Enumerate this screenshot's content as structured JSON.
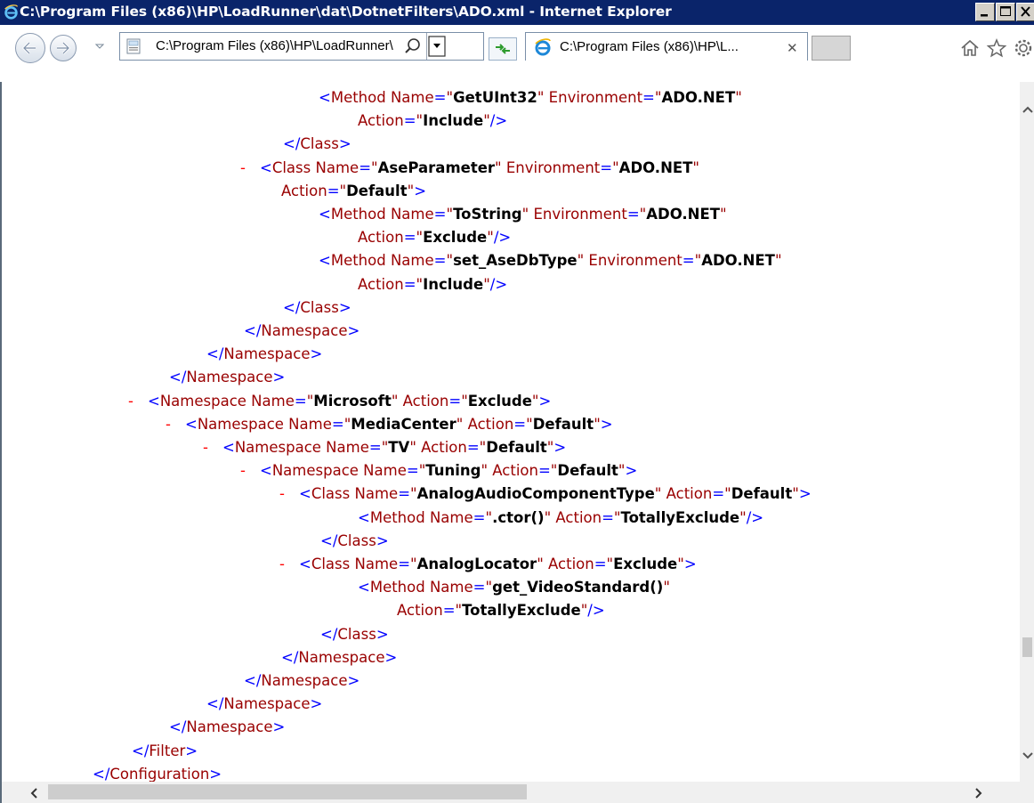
{
  "window": {
    "title": "C:\\Program Files (x86)\\HP\\LoadRunner\\dat\\DotnetFilters\\ADO.xml - Internet Explorer",
    "min_label": "_",
    "max_label": "□",
    "close_label": "✕"
  },
  "toolbar": {
    "address_text": "C:\\Program Files (x86)\\HP\\LoadRunner\\",
    "tab_title": "C:\\Program Files (x86)\\HP\\L...",
    "tab_close": "✕"
  },
  "icons": {
    "title": "ie-logo-icon",
    "back": "back-arrow-icon",
    "forward": "forward-arrow-icon",
    "page": "page-icon",
    "search": "search-icon",
    "refresh": "refresh-icon",
    "home": "home-icon",
    "favorites": "star-icon",
    "tools": "gear-icon"
  },
  "colors": {
    "titlebar": "#0a246a",
    "tag_bracket": "#0000ff",
    "tag_name": "#990000",
    "collapse_hyphen": "#ff0000",
    "value": "#000000"
  },
  "xml_lines": [
    {
      "indent": 356,
      "hy": false,
      "parts": [
        [
          "bk",
          "<"
        ],
        [
          "tg",
          "Method"
        ],
        [
          "at",
          " Name"
        ],
        [
          "bk",
          "="
        ],
        [
          "q",
          "\""
        ],
        [
          "v",
          "GetUInt32"
        ],
        [
          "q",
          "\""
        ],
        [
          "at",
          " Environment"
        ],
        [
          "bk",
          "="
        ],
        [
          "q",
          "\""
        ],
        [
          "v",
          "ADO.NET"
        ],
        [
          "q",
          "\""
        ]
      ]
    },
    {
      "indent": 400,
      "hy": false,
      "parts": [
        [
          "at",
          "Action"
        ],
        [
          "bk",
          "="
        ],
        [
          "q",
          "\""
        ],
        [
          "v",
          "Include"
        ],
        [
          "q",
          "\""
        ],
        [
          "bk",
          "/>"
        ]
      ]
    },
    {
      "indent": 316,
      "hy": false,
      "parts": [
        [
          "bk",
          "</"
        ],
        [
          "tg",
          "Class"
        ],
        [
          "bk",
          ">"
        ]
      ]
    },
    {
      "indent": 290,
      "hy": true,
      "parts": [
        [
          "bk",
          "<"
        ],
        [
          "tg",
          "Class"
        ],
        [
          "at",
          " Name"
        ],
        [
          "bk",
          "="
        ],
        [
          "q",
          "\""
        ],
        [
          "v",
          "AseParameter"
        ],
        [
          "q",
          "\""
        ],
        [
          "at",
          " Environment"
        ],
        [
          "bk",
          "="
        ],
        [
          "q",
          "\""
        ],
        [
          "v",
          "ADO.NET"
        ],
        [
          "q",
          "\""
        ]
      ]
    },
    {
      "indent": 314,
      "hy": false,
      "parts": [
        [
          "at",
          "Action"
        ],
        [
          "bk",
          "="
        ],
        [
          "q",
          "\""
        ],
        [
          "v",
          "Default"
        ],
        [
          "q",
          "\""
        ],
        [
          "bk",
          ">"
        ]
      ]
    },
    {
      "indent": 356,
      "hy": false,
      "parts": [
        [
          "bk",
          "<"
        ],
        [
          "tg",
          "Method"
        ],
        [
          "at",
          " Name"
        ],
        [
          "bk",
          "="
        ],
        [
          "q",
          "\""
        ],
        [
          "v",
          "ToString"
        ],
        [
          "q",
          "\""
        ],
        [
          "at",
          " Environment"
        ],
        [
          "bk",
          "="
        ],
        [
          "q",
          "\""
        ],
        [
          "v",
          "ADO.NET"
        ],
        [
          "q",
          "\""
        ]
      ]
    },
    {
      "indent": 400,
      "hy": false,
      "parts": [
        [
          "at",
          "Action"
        ],
        [
          "bk",
          "="
        ],
        [
          "q",
          "\""
        ],
        [
          "v",
          "Exclude"
        ],
        [
          "q",
          "\""
        ],
        [
          "bk",
          "/>"
        ]
      ]
    },
    {
      "indent": 356,
      "hy": false,
      "parts": [
        [
          "bk",
          "<"
        ],
        [
          "tg",
          "Method"
        ],
        [
          "at",
          " Name"
        ],
        [
          "bk",
          "="
        ],
        [
          "q",
          "\""
        ],
        [
          "v",
          "set_AseDbType"
        ],
        [
          "q",
          "\""
        ],
        [
          "at",
          " Environment"
        ],
        [
          "bk",
          "="
        ],
        [
          "q",
          "\""
        ],
        [
          "v",
          "ADO.NET"
        ],
        [
          "q",
          "\""
        ]
      ]
    },
    {
      "indent": 400,
      "hy": false,
      "parts": [
        [
          "at",
          "Action"
        ],
        [
          "bk",
          "="
        ],
        [
          "q",
          "\""
        ],
        [
          "v",
          "Include"
        ],
        [
          "q",
          "\""
        ],
        [
          "bk",
          "/>"
        ]
      ]
    },
    {
      "indent": 316,
      "hy": false,
      "parts": [
        [
          "bk",
          "</"
        ],
        [
          "tg",
          "Class"
        ],
        [
          "bk",
          ">"
        ]
      ]
    },
    {
      "indent": 272,
      "hy": false,
      "parts": [
        [
          "bk",
          "</"
        ],
        [
          "tg",
          "Namespace"
        ],
        [
          "bk",
          ">"
        ]
      ]
    },
    {
      "indent": 230,
      "hy": false,
      "parts": [
        [
          "bk",
          "</"
        ],
        [
          "tg",
          "Namespace"
        ],
        [
          "bk",
          ">"
        ]
      ]
    },
    {
      "indent": 188,
      "hy": false,
      "parts": [
        [
          "bk",
          "</"
        ],
        [
          "tg",
          "Namespace"
        ],
        [
          "bk",
          ">"
        ]
      ]
    },
    {
      "indent": 164,
      "hy": true,
      "parts": [
        [
          "bk",
          "<"
        ],
        [
          "tg",
          "Namespace"
        ],
        [
          "at",
          " Name"
        ],
        [
          "bk",
          "="
        ],
        [
          "q",
          "\""
        ],
        [
          "v",
          "Microsoft"
        ],
        [
          "q",
          "\""
        ],
        [
          "at",
          " Action"
        ],
        [
          "bk",
          "="
        ],
        [
          "q",
          "\""
        ],
        [
          "v",
          "Exclude"
        ],
        [
          "q",
          "\""
        ],
        [
          "bk",
          ">"
        ]
      ]
    },
    {
      "indent": 206,
      "hy": true,
      "parts": [
        [
          "bk",
          "<"
        ],
        [
          "tg",
          "Namespace"
        ],
        [
          "at",
          " Name"
        ],
        [
          "bk",
          "="
        ],
        [
          "q",
          "\""
        ],
        [
          "v",
          "MediaCenter"
        ],
        [
          "q",
          "\""
        ],
        [
          "at",
          " Action"
        ],
        [
          "bk",
          "="
        ],
        [
          "q",
          "\""
        ],
        [
          "v",
          "Default"
        ],
        [
          "q",
          "\""
        ],
        [
          "bk",
          ">"
        ]
      ]
    },
    {
      "indent": 248,
      "hy": true,
      "parts": [
        [
          "bk",
          "<"
        ],
        [
          "tg",
          "Namespace"
        ],
        [
          "at",
          " Name"
        ],
        [
          "bk",
          "="
        ],
        [
          "q",
          "\""
        ],
        [
          "v",
          "TV"
        ],
        [
          "q",
          "\""
        ],
        [
          "at",
          " Action"
        ],
        [
          "bk",
          "="
        ],
        [
          "q",
          "\""
        ],
        [
          "v",
          "Default"
        ],
        [
          "q",
          "\""
        ],
        [
          "bk",
          ">"
        ]
      ]
    },
    {
      "indent": 290,
      "hy": true,
      "parts": [
        [
          "bk",
          "<"
        ],
        [
          "tg",
          "Namespace"
        ],
        [
          "at",
          " Name"
        ],
        [
          "bk",
          "="
        ],
        [
          "q",
          "\""
        ],
        [
          "v",
          "Tuning"
        ],
        [
          "q",
          "\""
        ],
        [
          "at",
          " Action"
        ],
        [
          "bk",
          "="
        ],
        [
          "q",
          "\""
        ],
        [
          "v",
          "Default"
        ],
        [
          "q",
          "\""
        ],
        [
          "bk",
          ">"
        ]
      ]
    },
    {
      "indent": 334,
      "hy": true,
      "parts": [
        [
          "bk",
          "<"
        ],
        [
          "tg",
          "Class"
        ],
        [
          "at",
          " Name"
        ],
        [
          "bk",
          "="
        ],
        [
          "q",
          "\""
        ],
        [
          "v",
          "AnalogAudioComponentType"
        ],
        [
          "q",
          "\""
        ],
        [
          "at",
          " Action"
        ],
        [
          "bk",
          "="
        ],
        [
          "q",
          "\""
        ],
        [
          "v",
          "Default"
        ],
        [
          "q",
          "\""
        ],
        [
          "bk",
          ">"
        ]
      ]
    },
    {
      "indent": 400,
      "hy": false,
      "parts": [
        [
          "bk",
          "<"
        ],
        [
          "tg",
          "Method"
        ],
        [
          "at",
          " Name"
        ],
        [
          "bk",
          "="
        ],
        [
          "q",
          "\""
        ],
        [
          "v",
          ".ctor()"
        ],
        [
          "q",
          "\""
        ],
        [
          "at",
          " Action"
        ],
        [
          "bk",
          "="
        ],
        [
          "q",
          "\""
        ],
        [
          "v",
          "TotallyExclude"
        ],
        [
          "q",
          "\""
        ],
        [
          "bk",
          "/>"
        ]
      ]
    },
    {
      "indent": 358,
      "hy": false,
      "parts": [
        [
          "bk",
          "</"
        ],
        [
          "tg",
          "Class"
        ],
        [
          "bk",
          ">"
        ]
      ]
    },
    {
      "indent": 334,
      "hy": true,
      "parts": [
        [
          "bk",
          "<"
        ],
        [
          "tg",
          "Class"
        ],
        [
          "at",
          " Name"
        ],
        [
          "bk",
          "="
        ],
        [
          "q",
          "\""
        ],
        [
          "v",
          "AnalogLocator"
        ],
        [
          "q",
          "\""
        ],
        [
          "at",
          " Action"
        ],
        [
          "bk",
          "="
        ],
        [
          "q",
          "\""
        ],
        [
          "v",
          "Exclude"
        ],
        [
          "q",
          "\""
        ],
        [
          "bk",
          ">"
        ]
      ]
    },
    {
      "indent": 400,
      "hy": false,
      "parts": [
        [
          "bk",
          "<"
        ],
        [
          "tg",
          "Method"
        ],
        [
          "at",
          " Name"
        ],
        [
          "bk",
          "="
        ],
        [
          "q",
          "\""
        ],
        [
          "v",
          "get_VideoStandard()"
        ],
        [
          "q",
          "\""
        ]
      ]
    },
    {
      "indent": 444,
      "hy": false,
      "parts": [
        [
          "at",
          "Action"
        ],
        [
          "bk",
          "="
        ],
        [
          "q",
          "\""
        ],
        [
          "v",
          "TotallyExclude"
        ],
        [
          "q",
          "\""
        ],
        [
          "bk",
          "/>"
        ]
      ]
    },
    {
      "indent": 358,
      "hy": false,
      "parts": [
        [
          "bk",
          "</"
        ],
        [
          "tg",
          "Class"
        ],
        [
          "bk",
          ">"
        ]
      ]
    },
    {
      "indent": 314,
      "hy": false,
      "parts": [
        [
          "bk",
          "</"
        ],
        [
          "tg",
          "Namespace"
        ],
        [
          "bk",
          ">"
        ]
      ]
    },
    {
      "indent": 272,
      "hy": false,
      "parts": [
        [
          "bk",
          "</"
        ],
        [
          "tg",
          "Namespace"
        ],
        [
          "bk",
          ">"
        ]
      ]
    },
    {
      "indent": 230,
      "hy": false,
      "parts": [
        [
          "bk",
          "</"
        ],
        [
          "tg",
          "Namespace"
        ],
        [
          "bk",
          ">"
        ]
      ]
    },
    {
      "indent": 188,
      "hy": false,
      "parts": [
        [
          "bk",
          "</"
        ],
        [
          "tg",
          "Namespace"
        ],
        [
          "bk",
          ">"
        ]
      ]
    },
    {
      "indent": 146,
      "hy": false,
      "parts": [
        [
          "bk",
          "</"
        ],
        [
          "tg",
          "Filter"
        ],
        [
          "bk",
          ">"
        ]
      ]
    },
    {
      "indent": 102,
      "hy": false,
      "parts": [
        [
          "bk",
          "</"
        ],
        [
          "tg",
          "Configuration"
        ],
        [
          "bk",
          ">"
        ]
      ]
    }
  ]
}
